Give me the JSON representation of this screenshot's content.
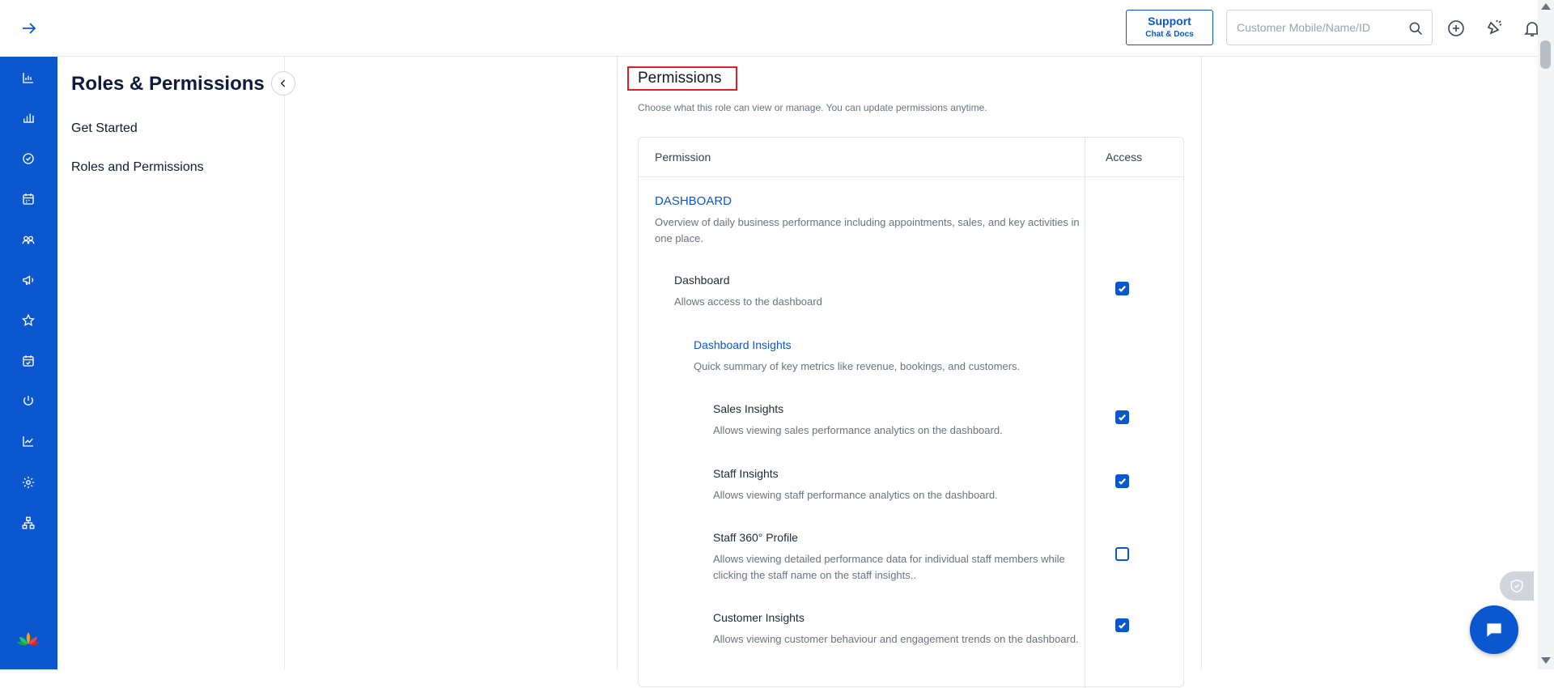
{
  "header": {
    "support_label": "Support",
    "support_sub": "Chat & Docs",
    "search_placeholder": "Customer Mobile/Name/ID"
  },
  "rail": {
    "icons": [
      "dashboard-icon",
      "reports-icon",
      "tasks-icon",
      "calendar-icon",
      "customers-icon",
      "marketing-icon",
      "reviews-icon",
      "appointments-icon",
      "services-icon",
      "analytics-icon",
      "settings-icon",
      "organization-icon"
    ]
  },
  "sidebar": {
    "title": "Roles & Permissions",
    "items": [
      {
        "label": "Get Started"
      },
      {
        "label": "Roles and Permissions"
      }
    ]
  },
  "main": {
    "title": "Permissions",
    "subtitle": "Choose what this role can view or manage. You can update permissions anytime.",
    "table": {
      "col_permission": "Permission",
      "col_access": "Access",
      "section": {
        "title": "DASHBOARD",
        "desc": "Overview of daily business performance including appointments, sales, and key activities in one place."
      },
      "dashboard": {
        "title": "Dashboard",
        "desc": "Allows access to the dashboard",
        "checked": true
      },
      "insights_group": {
        "title": "Dashboard Insights",
        "desc": "Quick summary of key metrics like revenue, bookings, and customers."
      },
      "rows": [
        {
          "title": "Sales Insights",
          "desc": "Allows viewing sales performance analytics on the dashboard.",
          "checked": true
        },
        {
          "title": "Staff Insights",
          "desc": "Allows viewing staff performance analytics on the dashboard.",
          "checked": true
        },
        {
          "title": "Staff 360° Profile",
          "desc": "Allows viewing detailed performance data for individual staff members while clicking the staff name on the staff insights..",
          "checked": false
        },
        {
          "title": "Customer Insights",
          "desc": "Allows viewing customer behaviour and engagement trends on the dashboard.",
          "checked": true
        }
      ]
    }
  },
  "colors": {
    "brand": "#0b57d0",
    "highlight": "#e11d2a"
  }
}
